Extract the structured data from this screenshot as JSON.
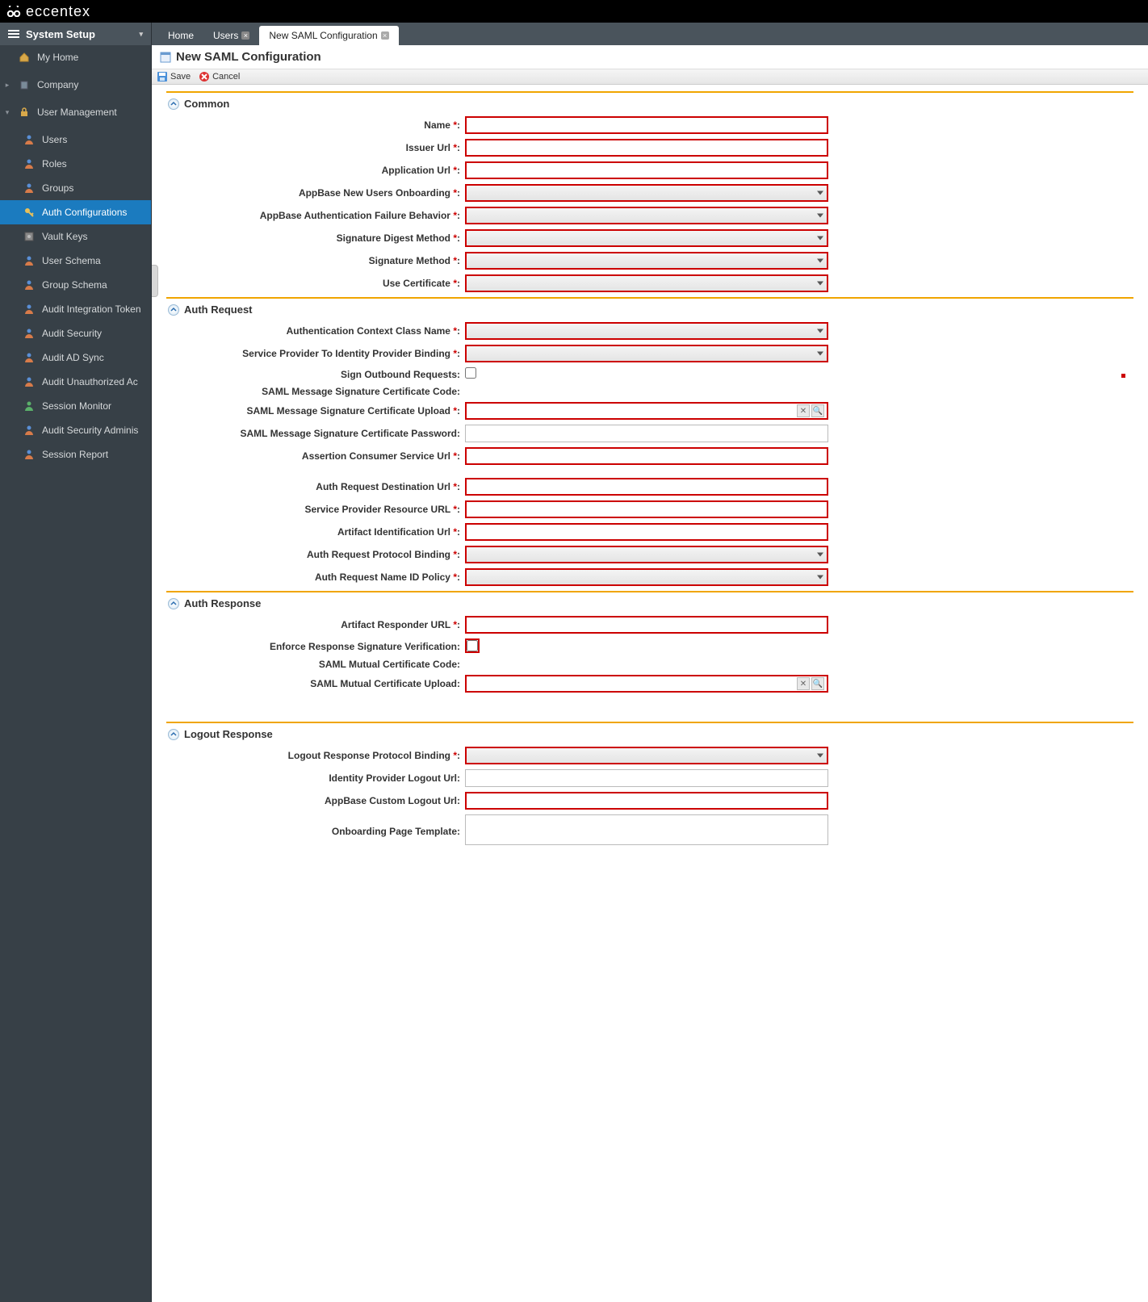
{
  "brand": "eccentex",
  "sidebar": {
    "header": "System Setup",
    "items": [
      {
        "label": "My Home",
        "icon": "home"
      },
      {
        "label": "Company",
        "icon": "company",
        "expandable": true
      },
      {
        "label": "User Management",
        "icon": "lock",
        "expandable": true,
        "expanded": true
      },
      {
        "label": "Users",
        "icon": "user",
        "child": true
      },
      {
        "label": "Roles",
        "icon": "user",
        "child": true
      },
      {
        "label": "Groups",
        "icon": "user",
        "child": true
      },
      {
        "label": "Auth Configurations",
        "icon": "key",
        "child": true,
        "active": true
      },
      {
        "label": "Vault Keys",
        "icon": "vault",
        "child": true
      },
      {
        "label": "User Schema",
        "icon": "user",
        "child": true
      },
      {
        "label": "Group Schema",
        "icon": "user",
        "child": true
      },
      {
        "label": "Audit Integration Token",
        "icon": "user",
        "child": true
      },
      {
        "label": "Audit Security",
        "icon": "user",
        "child": true
      },
      {
        "label": "Audit AD Sync",
        "icon": "user",
        "child": true
      },
      {
        "label": "Audit Unauthorized Ac",
        "icon": "user",
        "child": true
      },
      {
        "label": "Session Monitor",
        "icon": "user-green",
        "child": true
      },
      {
        "label": "Audit Security Adminis",
        "icon": "user",
        "child": true
      },
      {
        "label": "Session Report",
        "icon": "user",
        "child": true
      }
    ]
  },
  "tabs": [
    {
      "label": "Home",
      "closable": false
    },
    {
      "label": "Users",
      "closable": true
    },
    {
      "label": "New SAML Configuration",
      "closable": true,
      "active": true
    }
  ],
  "page": {
    "title": "New SAML Configuration"
  },
  "toolbar": {
    "save": "Save",
    "cancel": "Cancel"
  },
  "sections": {
    "common": {
      "title": "Common",
      "fields": {
        "name": "Name",
        "issuer_url": "Issuer Url",
        "application_url": "Application Url",
        "onboarding": "AppBase New Users Onboarding",
        "auth_failure": "AppBase Authentication Failure Behavior",
        "digest_method": "Signature Digest Method",
        "sig_method": "Signature Method",
        "use_cert": "Use Certificate"
      }
    },
    "auth_request": {
      "title": "Auth Request",
      "fields": {
        "context_class": "Authentication Context Class Name",
        "sp_to_idp_binding": "Service Provider To Identity Provider Binding",
        "sign_outbound": "Sign Outbound Requests:",
        "sig_cert_code": "SAML Message Signature Certificate Code:",
        "sig_cert_upload": "SAML Message Signature Certificate Upload",
        "sig_cert_password": "SAML Message Signature Certificate Password:",
        "acs_url": "Assertion Consumer Service Url",
        "dest_url": "Auth Request Destination Url",
        "sp_resource_url": "Service Provider Resource URL",
        "artifact_id_url": "Artifact Identification Url",
        "protocol_binding": "Auth Request Protocol Binding",
        "nameid_policy": "Auth Request Name ID Policy"
      }
    },
    "auth_response": {
      "title": "Auth Response",
      "fields": {
        "artifact_responder": "Artifact Responder URL",
        "enforce_sig_verify": "Enforce Response Signature Verification:",
        "mutual_cert_code": "SAML Mutual Certificate Code:",
        "mutual_cert_upload": "SAML Mutual Certificate Upload:"
      }
    },
    "logout_response": {
      "title": "Logout Response",
      "fields": {
        "protocol_binding": "Logout Response Protocol Binding",
        "idp_logout_url": "Identity Provider Logout Url:",
        "custom_logout_url": "AppBase Custom Logout Url:",
        "onboarding_template": "Onboarding Page Template:"
      }
    }
  }
}
